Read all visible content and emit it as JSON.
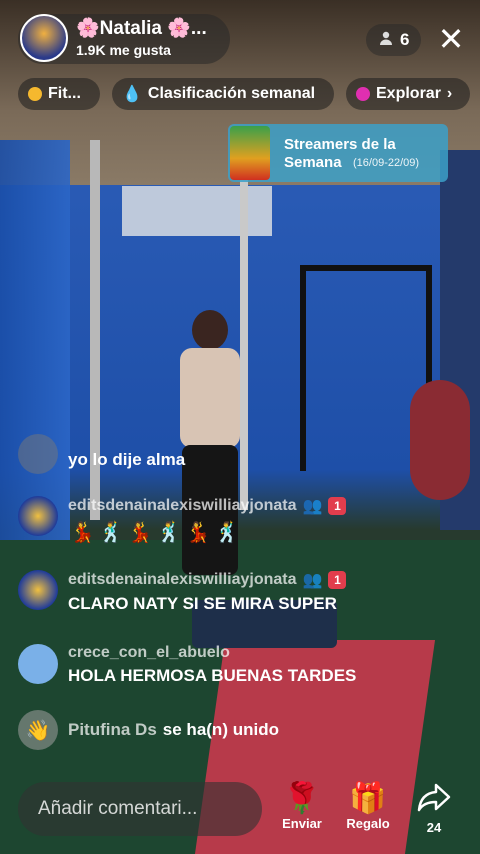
{
  "host": {
    "name": "🌸Natalia 🌸...",
    "likes": "1.9K me gusta",
    "viewers": "6"
  },
  "chips": [
    {
      "label": "Fit...",
      "dot_color": "#f5b82e"
    },
    {
      "label": "Clasificación semanal",
      "dot_color": "#f0a818"
    },
    {
      "label": "Explorar",
      "dot_color": "#e02fb0"
    }
  ],
  "banner": {
    "line1": "Streamers de la",
    "line2": "Semana",
    "dates": "(16/09-22/09)"
  },
  "comments": [
    {
      "user": "",
      "message": "yo lo dije alma"
    },
    {
      "user": "editsdenainalexiswilliayjonata",
      "level": "1",
      "message": ""
    },
    {
      "user": "editsdenainalexiswilliayjonata",
      "level": "1",
      "message": "CLARO NATY SI SE MIRA SUPER"
    },
    {
      "user": "crece_con_el_abuelo",
      "message": "HOLA HERMOSA BUENAS TARDES"
    },
    {
      "user": "Pitufina Ds",
      "message": "se ha(n) unido"
    }
  ],
  "emoji_row": "💃🕺💃🕺💃🕺",
  "bottom": {
    "comment_placeholder": "Añadir comentari...",
    "send_label": "Enviar",
    "gift_label": "Regalo",
    "share_count": "24"
  }
}
